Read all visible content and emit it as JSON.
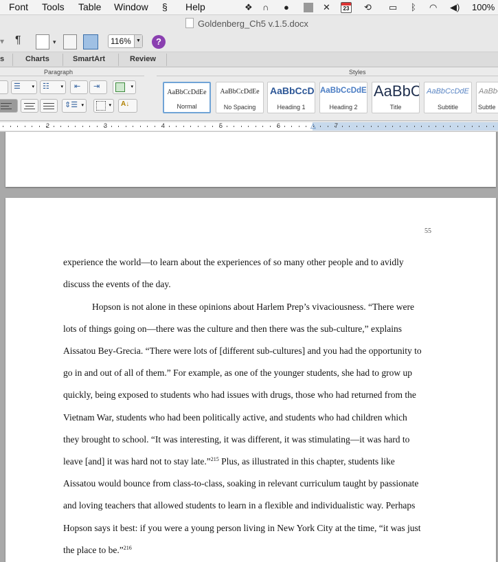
{
  "menubar": {
    "items": [
      "Font",
      "Tools",
      "Table",
      "Window",
      "Help"
    ],
    "calendar_day": "23",
    "battery": "100%"
  },
  "window": {
    "title": "Goldenberg_Ch5 v.1.5.docx"
  },
  "toolbar": {
    "zoom": "116%",
    "help_label": "?"
  },
  "ribbon": {
    "tabs": [
      "s",
      "Charts",
      "SmartArt",
      "Review"
    ],
    "groups": {
      "paragraph": "Paragraph",
      "styles": "Styles"
    },
    "styles": [
      {
        "sample": "AaBbCcDdEe",
        "name": "Normal"
      },
      {
        "sample": "AaBbCcDdEe",
        "name": "No Spacing"
      },
      {
        "sample": "AaBbCcDd",
        "name": "Heading 1"
      },
      {
        "sample": "AaBbCcDdEe",
        "name": "Heading 2"
      },
      {
        "sample": "AaBbC",
        "name": "Title"
      },
      {
        "sample": "AaBbCcDdE",
        "name": "Subtitle"
      },
      {
        "sample": "AaBbCcDd",
        "name": "Subtle"
      }
    ]
  },
  "ruler": {
    "numbers": [
      "2",
      "3",
      "4",
      "5",
      "6",
      "7"
    ]
  },
  "document": {
    "page_number": "55",
    "lines": [
      "experience the world—to learn about the experiences of so many other people and to avidly",
      "discuss the events of the day.",
      "Hopson is not alone in these opinions about Harlem Prep’s vivaciousness. “There were",
      "lots of things going on—there was the culture and then there was the sub-culture,” explains",
      "Aissatou Bey-Grecia. “There were lots of [different sub-cultures] and you had the opportunity to",
      "go in and out of all of them.” For example, as one of the younger students, she had to grow up",
      "quickly, being exposed to students who had issues with drugs, those who had returned from the",
      "Vietnam War, students who had been politically active, and students who had children which",
      "they brought to school. “It was interesting, it was different, it was stimulating—it was hard to",
      "leave [and] it was hard not to stay late.”",
      "Aissatou would bounce from class-to-class, soaking in relevant curriculum taught by passionate",
      "and loving teachers that allowed students to learn in a flexible and individualistic way. Perhaps",
      "Hopson says it best: if you were a young person living in New York City at the time, “it was just",
      "the place to be.”"
    ],
    "footnote_215": "215",
    "line10_rest": " Plus, as illustrated in this chapter, students like",
    "footnote_216": "216"
  }
}
